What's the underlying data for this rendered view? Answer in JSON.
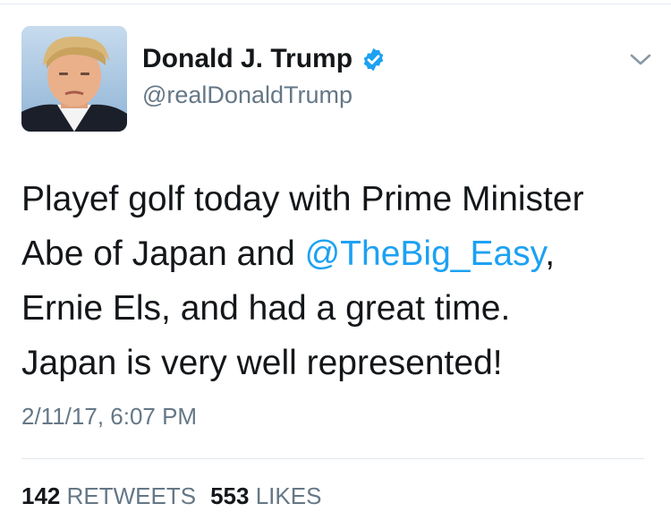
{
  "author": {
    "display_name": "Donald J. Trump",
    "handle": "@realDonaldTrump",
    "verified_icon": "verified-badge-icon",
    "avatar": "profile-photo"
  },
  "menu_icon": "chevron-down-icon",
  "tweet": {
    "line1": "Playef golf today with Prime Minister",
    "line2_pre": "Abe of Japan and ",
    "line2_mention": "@TheBig_Easy",
    "line2_post": ",",
    "line3": "Ernie Els, and had a great time.",
    "line4": "Japan is very well represented!"
  },
  "timestamp": "2/11/17, 6:07 PM",
  "stats": {
    "retweets_count": "142",
    "retweets_label": "RETWEETS",
    "likes_count": "553",
    "likes_label": "LIKES"
  },
  "colors": {
    "link": "#1da1f2",
    "secondary_text": "#657786",
    "primary_text": "#14171a",
    "verified": "#1da1f2"
  }
}
